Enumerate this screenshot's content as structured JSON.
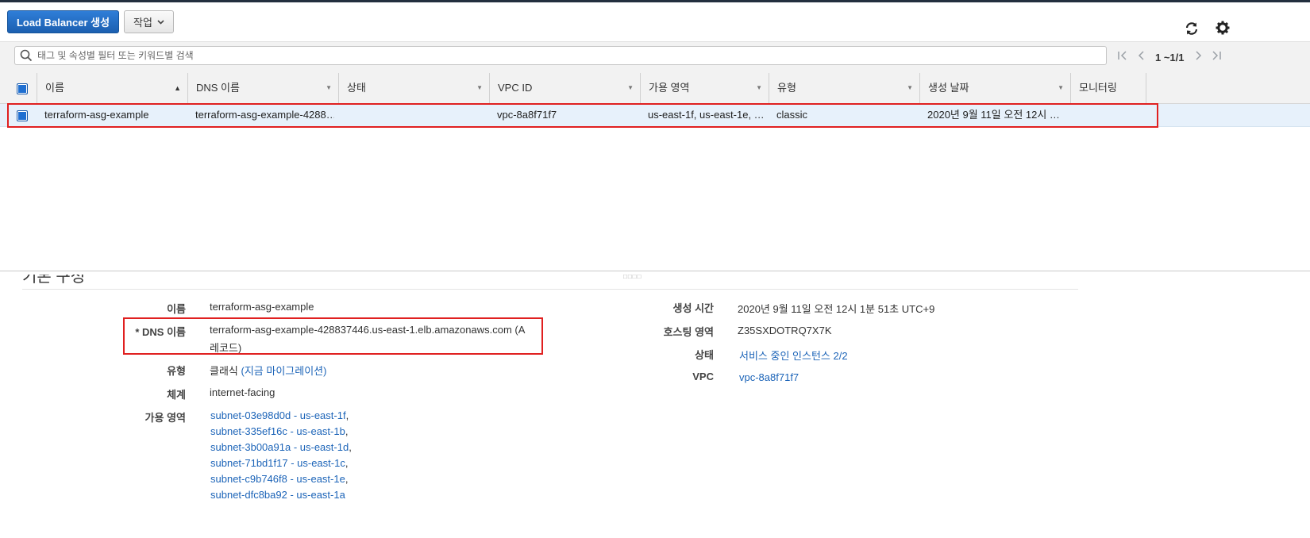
{
  "toolbar": {
    "create_label": "Load Balancer 생성",
    "actions_label": "작업"
  },
  "search": {
    "placeholder": "태그 및 속성별 필터 또는 키워드별 검색"
  },
  "pagination": {
    "text": "1 ~1/1"
  },
  "table": {
    "columns": [
      "이름",
      "DNS 이름",
      "상태",
      "VPC ID",
      "가용 영역",
      "유형",
      "생성 날짜",
      "모니터링"
    ],
    "rows": [
      {
        "name": "terraform-asg-example",
        "dns": "terraform-asg-example-4288…",
        "state": "",
        "vpc": "vpc-8a8f71f7",
        "az": "us-east-1f, us-east-1e, …",
        "type": "classic",
        "created": "2020년 9월 11일 오전 12시 …"
      }
    ]
  },
  "detail": {
    "section_title": "기본 구성",
    "name_label": "이름",
    "name_value": "terraform-asg-example",
    "dns_label": "* DNS 이름",
    "dns_value_line1": "terraform-asg-example-428837446.us-east-1.elb.amazonaws.com (A",
    "dns_value_line2": "레코드)",
    "type_label": "유형",
    "type_value": "클래식",
    "type_link": "(지금 마이그레이션)",
    "scheme_label": "체계",
    "scheme_value": "internet-facing",
    "az_label": "가용 영역",
    "subnets": [
      "subnet-03e98d0d - us-east-1f",
      "subnet-335ef16c - us-east-1b",
      "subnet-3b00a91a - us-east-1d",
      "subnet-71bd1f17 - us-east-1c",
      "subnet-c9b746f8 - us-east-1e",
      "subnet-dfc8ba92 - us-east-1a"
    ],
    "created_label": "생성 시간",
    "created_value": "2020년 9월 11일 오전 12시 1분 51초 UTC+9",
    "zone_label": "호스팅 영역",
    "zone_value": "Z35SXDOTRQ7X7K",
    "status_label": "상태",
    "status_value": "서비스 중인 인스턴스 2/2",
    "vpc_label": "VPC",
    "vpc_value": "vpc-8a8f71f7"
  },
  "colors": {
    "primary": "#1b5fb0",
    "link": "#1c64b8",
    "highlight_box": "#e02020",
    "selected_row": "#e7f1fb"
  },
  "icons": [
    "refresh-icon",
    "settings-gear-icon",
    "search-icon",
    "first-page-icon",
    "prev-page-icon",
    "next-page-icon",
    "last-page-icon",
    "chevron-down-icon"
  ]
}
